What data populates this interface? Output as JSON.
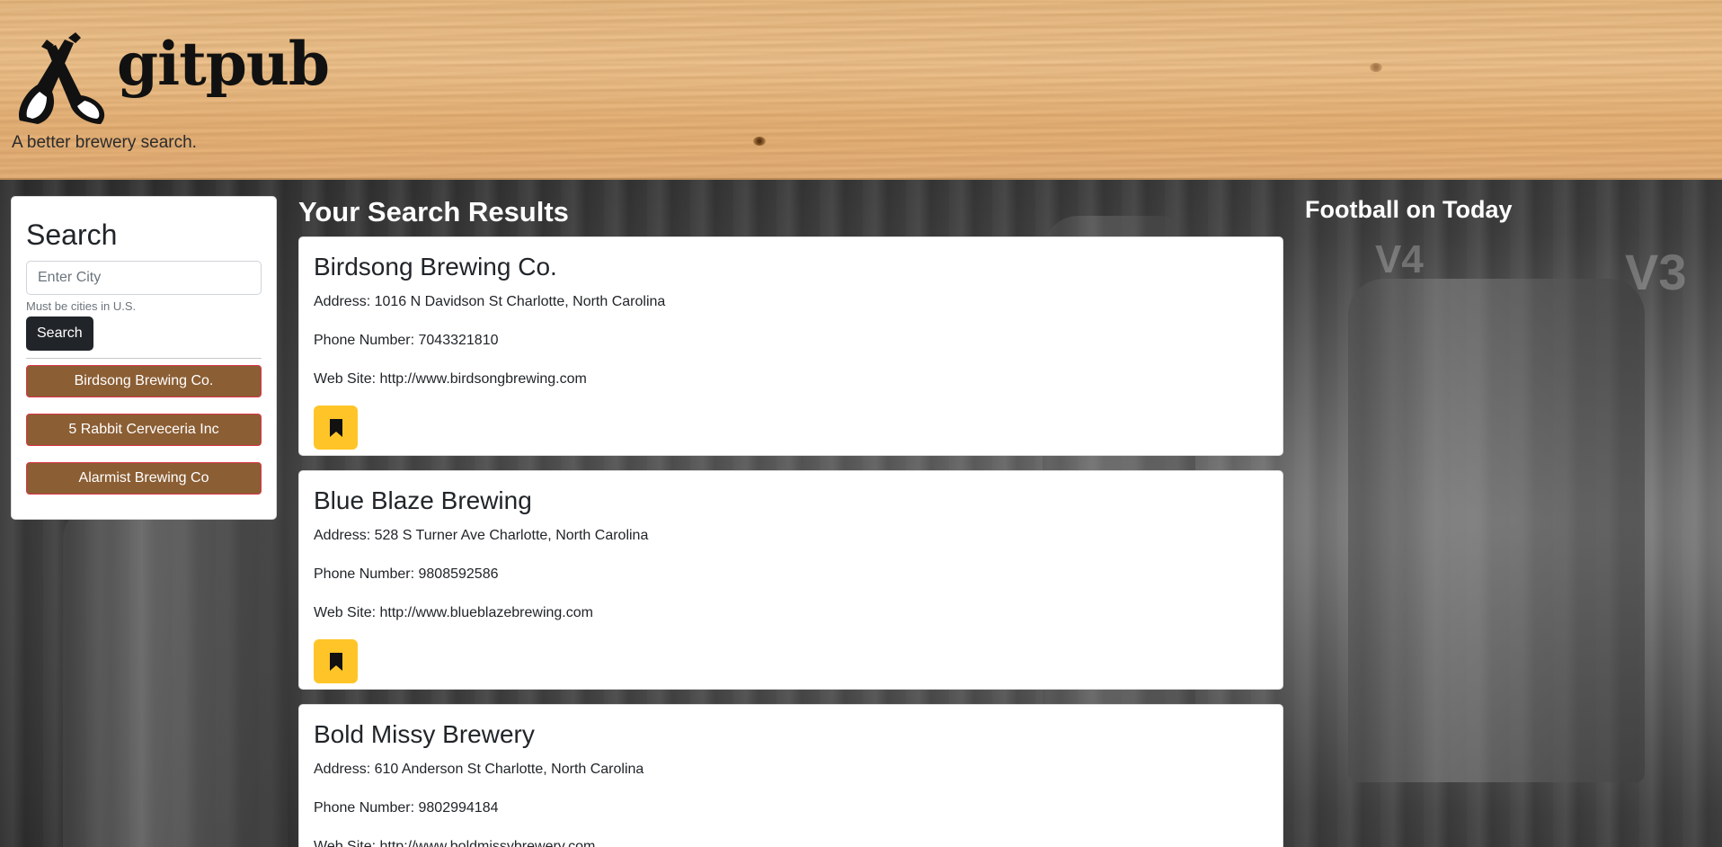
{
  "header": {
    "logo_text": "gitpub",
    "tagline": "A better brewery search."
  },
  "sidebar": {
    "title": "Search",
    "input_placeholder": "Enter City",
    "input_value": "",
    "hint": "Must be cities in U.S.",
    "search_label": "Search",
    "history": [
      {
        "label": "Birdsong Brewing Co."
      },
      {
        "label": "5 Rabbit Cerveceria Inc"
      },
      {
        "label": "Alarmist Brewing Co"
      }
    ]
  },
  "results": {
    "title": "Your Search Results",
    "cards": [
      {
        "name": "Birdsong Brewing Co.",
        "address": "Address: 1016 N Davidson St Charlotte, North Carolina",
        "phone": "Phone Number: 7043321810",
        "website": "Web Site: http://www.birdsongbrewing.com",
        "bookmark_icon": "bookmark-icon"
      },
      {
        "name": "Blue Blaze Brewing",
        "address": "Address: 528 S Turner Ave Charlotte, North Carolina",
        "phone": "Phone Number: 9808592586",
        "website": "Web Site: http://www.blueblazebrewing.com",
        "bookmark_icon": "bookmark-icon"
      },
      {
        "name": "Bold Missy Brewery",
        "address": "Address: 610 Anderson St Charlotte, North Carolina",
        "phone": "Phone Number: 9802994184",
        "website": "Web Site: http://www.boldmissybrewery.com"
      }
    ]
  },
  "right": {
    "title": "Football on Today"
  },
  "colors": {
    "history_button": "#8b5e34",
    "bookmark_button": "#ffc528",
    "search_button": "#212529"
  }
}
